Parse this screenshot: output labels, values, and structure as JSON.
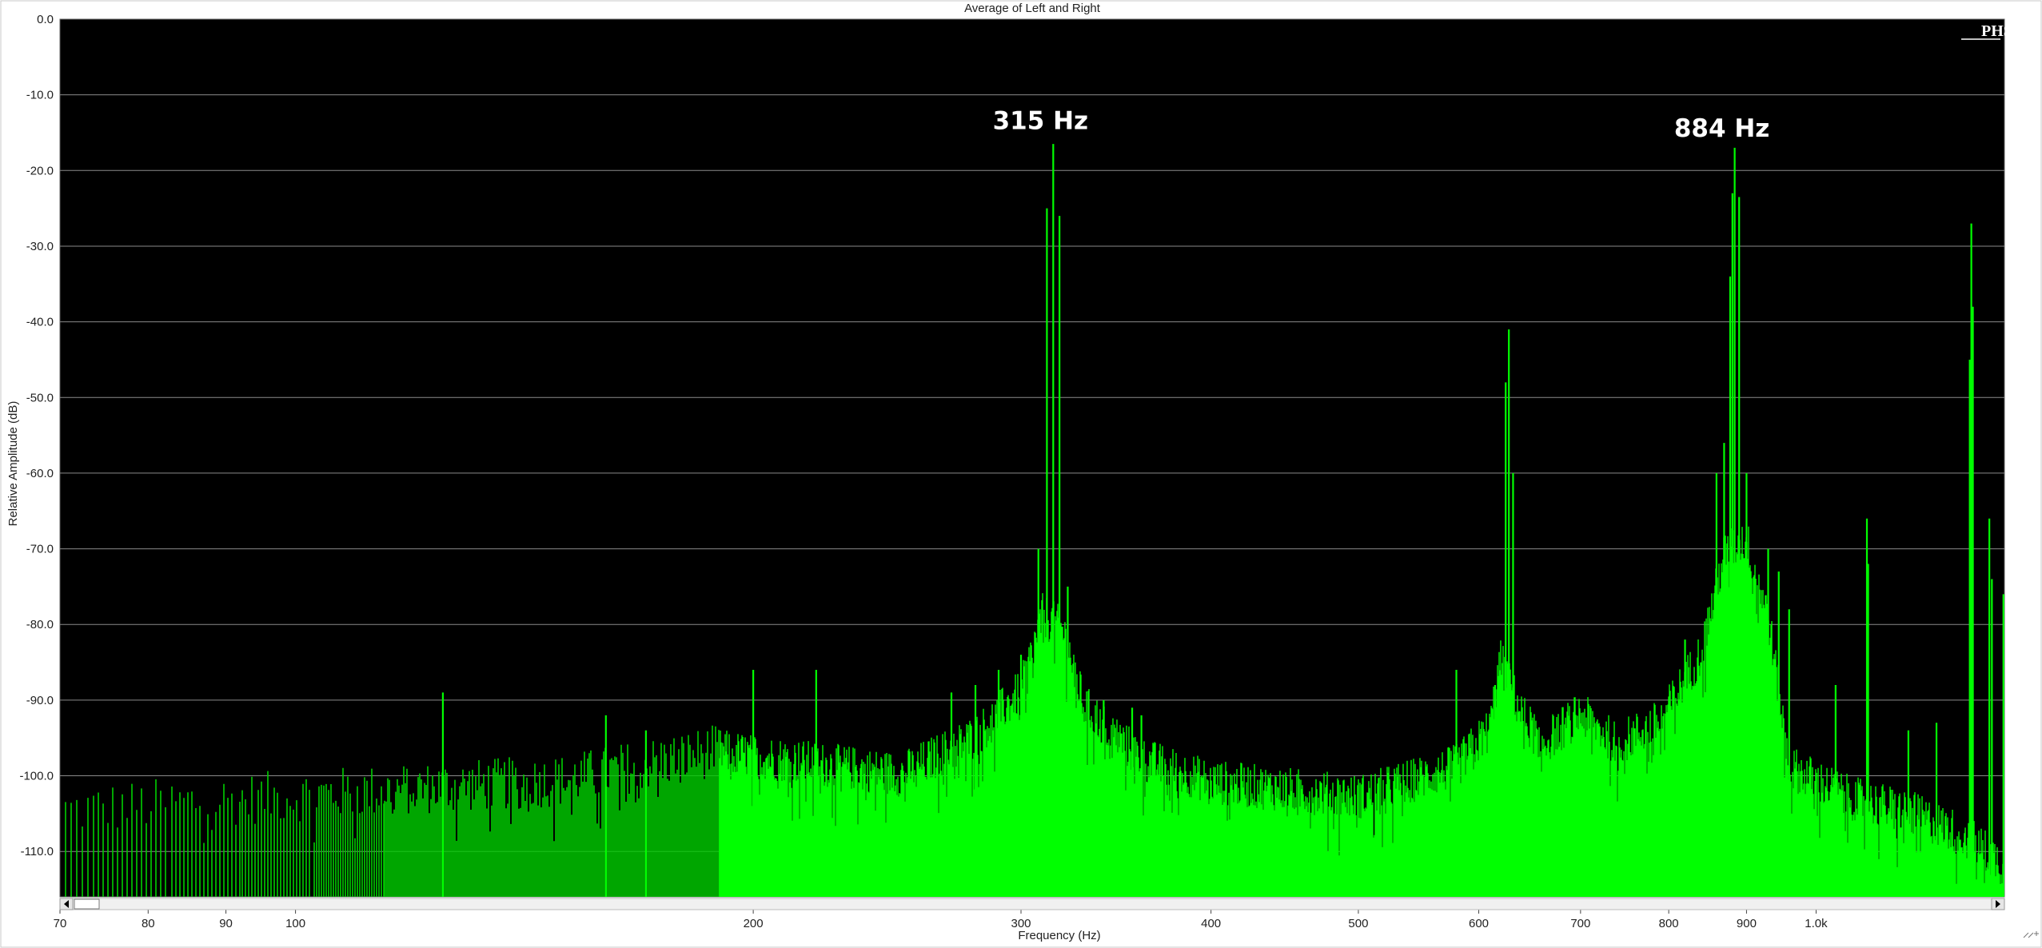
{
  "chart_data": {
    "type": "area",
    "title": "Average of Left and Right",
    "xlabel": "Frequency (Hz)",
    "ylabel": "Relative Amplitude (dB)",
    "xscale": "log",
    "xlim": [
      70,
      1330
    ],
    "ylim": [
      -116,
      0
    ],
    "grid": "horizontal",
    "background": "#000000",
    "fill_color": "#00ff00",
    "yticks": [
      "0.0",
      "-10.0",
      "-20.0",
      "-30.0",
      "-40.0",
      "-50.0",
      "-60.0",
      "-70.0",
      "-80.0",
      "-90.0",
      "-100.0",
      "-110.0"
    ],
    "ytick_values": [
      0,
      -10,
      -20,
      -30,
      -40,
      -50,
      -60,
      -70,
      -80,
      -90,
      -100,
      -110
    ],
    "xticks": [
      {
        "value": 70,
        "label": "70"
      },
      {
        "value": 80,
        "label": "80"
      },
      {
        "value": 90,
        "label": "90"
      },
      {
        "value": 100,
        "label": "100"
      },
      {
        "value": 200,
        "label": "200"
      },
      {
        "value": 300,
        "label": "300"
      },
      {
        "value": 400,
        "label": "400"
      },
      {
        "value": 500,
        "label": "500"
      },
      {
        "value": 600,
        "label": "600"
      },
      {
        "value": 700,
        "label": "700"
      },
      {
        "value": 800,
        "label": "800"
      },
      {
        "value": 900,
        "label": "900"
      },
      {
        "value": 1000,
        "label": "1.0k"
      }
    ],
    "annotations": [
      {
        "text": "315 Hz",
        "x": 315,
        "y": -16
      },
      {
        "text": "884 Hz",
        "x": 884,
        "y": -17
      }
    ],
    "logo": "PHS",
    "floor_db": [
      [
        70,
        -106
      ],
      [
        100,
        -104
      ],
      [
        150,
        -102
      ],
      [
        190,
        -98
      ],
      [
        250,
        -101
      ],
      [
        280,
        -96
      ],
      [
        300,
        -90
      ],
      [
        310,
        -80
      ],
      [
        320,
        -82
      ],
      [
        330,
        -92
      ],
      [
        360,
        -99
      ],
      [
        400,
        -102
      ],
      [
        500,
        -104
      ],
      [
        580,
        -100
      ],
      [
        610,
        -95
      ],
      [
        620,
        -86
      ],
      [
        640,
        -93
      ],
      [
        660,
        -97
      ],
      [
        700,
        -93
      ],
      [
        740,
        -97
      ],
      [
        790,
        -94
      ],
      [
        840,
        -85
      ],
      [
        870,
        -72
      ],
      [
        900,
        -70
      ],
      [
        930,
        -80
      ],
      [
        960,
        -100
      ],
      [
        1050,
        -104
      ],
      [
        1150,
        -106
      ],
      [
        1250,
        -109
      ],
      [
        1330,
        -113
      ]
    ],
    "peaks": [
      {
        "x": 315,
        "y": -16.5
      },
      {
        "x": 312,
        "y": -25
      },
      {
        "x": 318,
        "y": -26
      },
      {
        "x": 308,
        "y": -70
      },
      {
        "x": 322,
        "y": -75
      },
      {
        "x": 300,
        "y": -84
      },
      {
        "x": 290,
        "y": -86
      },
      {
        "x": 280,
        "y": -88
      },
      {
        "x": 270,
        "y": -89
      },
      {
        "x": 340,
        "y": -90
      },
      {
        "x": 355,
        "y": -91
      },
      {
        "x": 360,
        "y": -92
      },
      {
        "x": 125,
        "y": -89
      },
      {
        "x": 200,
        "y": -86
      },
      {
        "x": 220,
        "y": -86
      },
      {
        "x": 160,
        "y": -92
      },
      {
        "x": 170,
        "y": -94
      },
      {
        "x": 628,
        "y": -41
      },
      {
        "x": 625,
        "y": -48
      },
      {
        "x": 632,
        "y": -60
      },
      {
        "x": 580,
        "y": -86
      },
      {
        "x": 615,
        "y": -88
      },
      {
        "x": 884,
        "y": -17
      },
      {
        "x": 881,
        "y": -23
      },
      {
        "x": 890,
        "y": -23.5
      },
      {
        "x": 878,
        "y": -34
      },
      {
        "x": 870,
        "y": -56
      },
      {
        "x": 860,
        "y": -60
      },
      {
        "x": 900,
        "y": -60
      },
      {
        "x": 930,
        "y": -70
      },
      {
        "x": 945,
        "y": -73
      },
      {
        "x": 960,
        "y": -78
      },
      {
        "x": 820,
        "y": -82
      },
      {
        "x": 840,
        "y": -85
      },
      {
        "x": 1030,
        "y": -88
      },
      {
        "x": 1080,
        "y": -66
      },
      {
        "x": 1082,
        "y": -72
      },
      {
        "x": 1150,
        "y": -94
      },
      {
        "x": 1200,
        "y": -93
      },
      {
        "x": 1265,
        "y": -27
      },
      {
        "x": 1268,
        "y": -38
      },
      {
        "x": 1262,
        "y": -45
      },
      {
        "x": 1300,
        "y": -66
      },
      {
        "x": 1305,
        "y": -74
      },
      {
        "x": 1328,
        "y": -76
      }
    ]
  }
}
